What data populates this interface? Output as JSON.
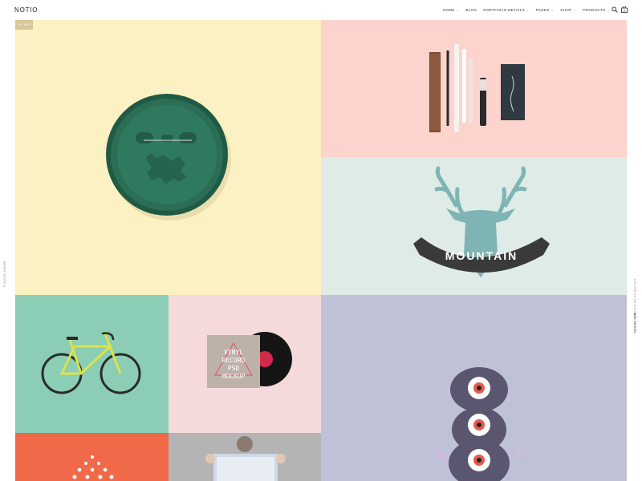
{
  "header": {
    "logo": "NOTIO",
    "nav": [
      {
        "label": "HOME",
        "has_dropdown": true
      },
      {
        "label": "BLOG",
        "has_dropdown": false
      },
      {
        "label": "PORTFOLIO DETAILS",
        "has_dropdown": true
      },
      {
        "label": "PAGES",
        "has_dropdown": true
      },
      {
        "label": "SHOP",
        "has_dropdown": true
      },
      {
        "label": "PRODUCTS",
        "has_dropdown": true
      }
    ],
    "icons": [
      "search-icon",
      "cart-icon"
    ],
    "cart_count": "0"
  },
  "side": {
    "left_text": "© NOTIO THEME",
    "right_text_1": "FOLLOW US ON SOCIAL",
    "right_text_2": "WEB DESIGN"
  },
  "grid": {
    "badge_label": "FILTERS",
    "deer_banner_text": "MOUNTAIN",
    "vinyl_text": [
      "VINYL",
      "RECORD",
      "PSD",
      "MOCKUP"
    ]
  },
  "colors": {
    "badge_bg": "#fcf1c2",
    "pencils_bg": "#fdd3cd",
    "deer_bg": "#deebe6",
    "bike_bg": "#8bcdb5",
    "vinyl_bg": "#f5dadc",
    "monster_bg": "#bfc2d6",
    "drops_bg": "#f06a4a",
    "poster_bg": "#b4b4b4"
  }
}
